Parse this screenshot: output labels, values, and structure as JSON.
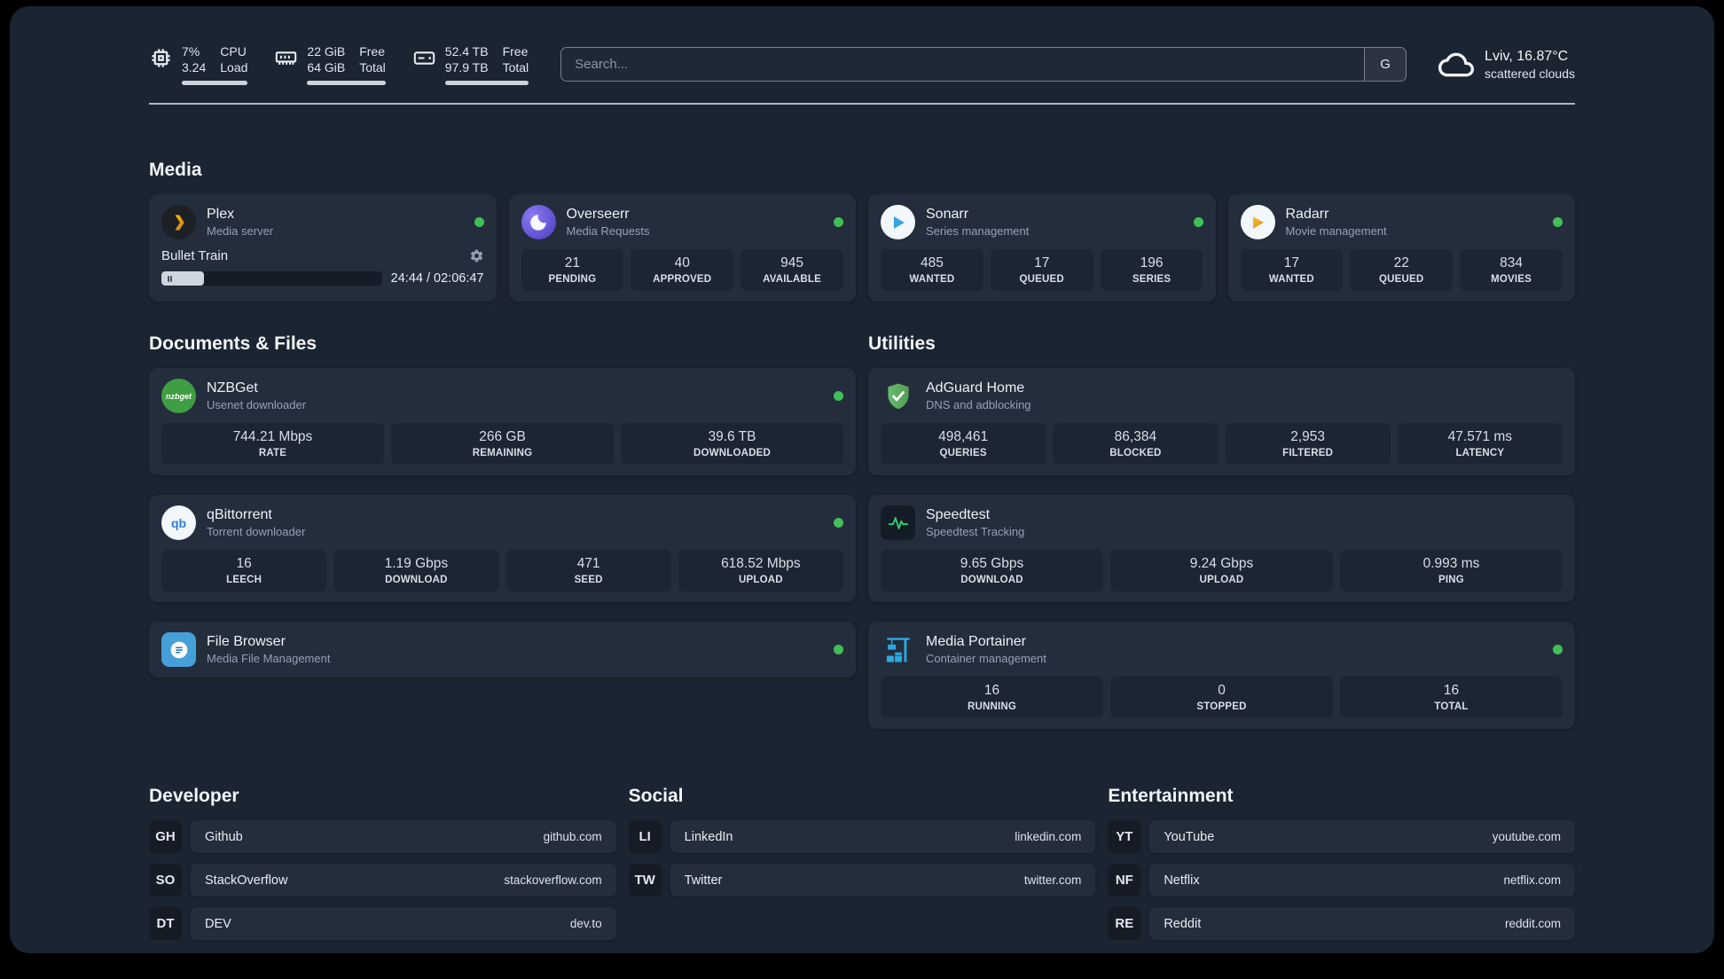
{
  "colors": {
    "background": "#1b2431",
    "card": "#242d3c",
    "tile": "#1c2533",
    "status_online": "#40c057",
    "plex_orange": "#e5a00d",
    "adguard_green": "#68bc71",
    "portainer_blue": "#29abe2"
  },
  "topbar": {
    "cpu": {
      "percent": "7%",
      "load": "3.24",
      "label_line1": "CPU",
      "label_line2": "Load"
    },
    "memory": {
      "free": "22 GiB",
      "total": "64 GiB",
      "label_line1": "Free",
      "label_line2": "Total"
    },
    "storage": {
      "free": "52.4 TB",
      "total": "97.9 TB",
      "label_line1": "Free",
      "label_line2": "Total"
    },
    "search": {
      "placeholder": "Search...",
      "engine_button": "G"
    },
    "weather": {
      "location": "Lviv, 16.87°C",
      "condition": "scattered clouds"
    }
  },
  "sections": {
    "media": "Media",
    "documents": "Documents & Files",
    "utilities": "Utilities",
    "developer": "Developer",
    "social": "Social",
    "entertainment": "Entertainment"
  },
  "apps": {
    "plex": {
      "name": "Plex",
      "subtitle": "Media server",
      "player": {
        "title": "Bullet Train",
        "time": "24:44 / 02:06:47",
        "progress_percent": 19.5
      }
    },
    "overseerr": {
      "name": "Overseerr",
      "subtitle": "Media Requests",
      "stats": [
        {
          "value": "21",
          "label": "PENDING"
        },
        {
          "value": "40",
          "label": "APPROVED"
        },
        {
          "value": "945",
          "label": "AVAILABLE"
        }
      ]
    },
    "sonarr": {
      "name": "Sonarr",
      "subtitle": "Series management",
      "stats": [
        {
          "value": "485",
          "label": "WANTED"
        },
        {
          "value": "17",
          "label": "QUEUED"
        },
        {
          "value": "196",
          "label": "SERIES"
        }
      ]
    },
    "radarr": {
      "name": "Radarr",
      "subtitle": "Movie management",
      "stats": [
        {
          "value": "17",
          "label": "WANTED"
        },
        {
          "value": "22",
          "label": "QUEUED"
        },
        {
          "value": "834",
          "label": "MOVIES"
        }
      ]
    },
    "nzbget": {
      "name": "NZBGet",
      "subtitle": "Usenet downloader",
      "icon_text": "nzbget",
      "stats": [
        {
          "value": "744.21 Mbps",
          "label": "RATE"
        },
        {
          "value": "266 GB",
          "label": "REMAINING"
        },
        {
          "value": "39.6 TB",
          "label": "DOWNLOADED"
        }
      ]
    },
    "qbittorrent": {
      "name": "qBittorrent",
      "subtitle": "Torrent downloader",
      "icon_text": "qb",
      "stats": [
        {
          "value": "16",
          "label": "LEECH"
        },
        {
          "value": "1.19 Gbps",
          "label": "DOWNLOAD"
        },
        {
          "value": "471",
          "label": "SEED"
        },
        {
          "value": "618.52 Mbps",
          "label": "UPLOAD"
        }
      ]
    },
    "filebrowser": {
      "name": "File Browser",
      "subtitle": "Media File Management"
    },
    "adguard": {
      "name": "AdGuard Home",
      "subtitle": "DNS and adblocking",
      "stats": [
        {
          "value": "498,461",
          "label": "QUERIES"
        },
        {
          "value": "86,384",
          "label": "BLOCKED"
        },
        {
          "value": "2,953",
          "label": "FILTERED"
        },
        {
          "value": "47.571 ms",
          "label": "LATENCY"
        }
      ]
    },
    "speedtest": {
      "name": "Speedtest",
      "subtitle": "Speedtest Tracking",
      "stats": [
        {
          "value": "9.65 Gbps",
          "label": "DOWNLOAD"
        },
        {
          "value": "9.24 Gbps",
          "label": "UPLOAD"
        },
        {
          "value": "0.993 ms",
          "label": "PING"
        }
      ]
    },
    "portainer": {
      "name": "Media Portainer",
      "subtitle": "Container management",
      "stats": [
        {
          "value": "16",
          "label": "RUNNING"
        },
        {
          "value": "0",
          "label": "STOPPED"
        },
        {
          "value": "16",
          "label": "TOTAL"
        }
      ]
    }
  },
  "bookmarks": {
    "developer": [
      {
        "abbr": "GH",
        "name": "Github",
        "url": "github.com"
      },
      {
        "abbr": "SO",
        "name": "StackOverflow",
        "url": "stackoverflow.com"
      },
      {
        "abbr": "DT",
        "name": "DEV",
        "url": "dev.to"
      }
    ],
    "social": [
      {
        "abbr": "LI",
        "name": "LinkedIn",
        "url": "linkedin.com"
      },
      {
        "abbr": "TW",
        "name": "Twitter",
        "url": "twitter.com"
      }
    ],
    "entertainment": [
      {
        "abbr": "YT",
        "name": "YouTube",
        "url": "youtube.com"
      },
      {
        "abbr": "NF",
        "name": "Netflix",
        "url": "netflix.com"
      },
      {
        "abbr": "RE",
        "name": "Reddit",
        "url": "reddit.com"
      }
    ]
  }
}
